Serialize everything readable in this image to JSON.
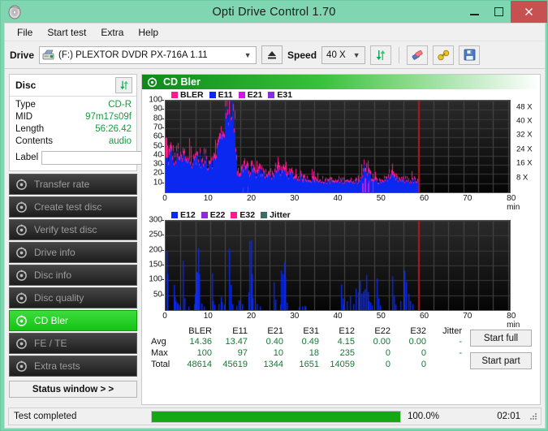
{
  "window": {
    "title": "Opti Drive Control 1.70",
    "app_icon": "disc-icon",
    "minimize": "–",
    "maximize": "□",
    "close": "✕"
  },
  "menu": [
    {
      "label": "File"
    },
    {
      "label": "Start test"
    },
    {
      "label": "Extra"
    },
    {
      "label": "Help"
    }
  ],
  "toolbar": {
    "drive_label": "Drive",
    "drive_value": "(F:)  PLEXTOR DVDR  PX-716A 1.11",
    "eject_icon": "eject-icon",
    "speed_label": "Speed",
    "speed_value": "40 X",
    "refresh_icon": "refresh-icon",
    "erase_icon": "eraser-icon",
    "tools_icon": "tools-icon",
    "save_icon": "save-icon"
  },
  "disc": {
    "header": "Disc",
    "refresh_icon": "refresh-icon",
    "rows": [
      {
        "key": "Type",
        "value": "CD-R"
      },
      {
        "key": "MID",
        "value": "97m17s09f"
      },
      {
        "key": "Length",
        "value": "56:26.42"
      },
      {
        "key": "Contents",
        "value": "audio"
      }
    ],
    "label_key": "Label",
    "label_value": "",
    "label_placeholder": "",
    "disc_icon": "cd-disc-icon"
  },
  "nav": [
    {
      "label": "Transfer rate",
      "icon": "gear-disc-icon",
      "active": false
    },
    {
      "label": "Create test disc",
      "icon": "gear-disc-icon",
      "active": false
    },
    {
      "label": "Verify test disc",
      "icon": "gear-disc-icon",
      "active": false
    },
    {
      "label": "Drive info",
      "icon": "gear-disc-icon",
      "active": false
    },
    {
      "label": "Disc info",
      "icon": "gear-disc-icon",
      "active": false
    },
    {
      "label": "Disc quality",
      "icon": "gear-disc-icon",
      "active": false
    },
    {
      "label": "CD Bler",
      "icon": "gear-disc-icon",
      "active": true
    },
    {
      "label": "FE / TE",
      "icon": "gear-disc-icon",
      "active": false
    },
    {
      "label": "Extra tests",
      "icon": "gear-disc-icon",
      "active": false
    }
  ],
  "status_window_button": "Status window > >",
  "main": {
    "header_title": "CD Bler",
    "header_icon": "gear-disc-icon"
  },
  "actions": {
    "start_full": "Start full",
    "start_part": "Start part"
  },
  "statusbar": {
    "text": "Test completed",
    "percent_label": "100.0%",
    "percent_value": 100.0,
    "elapsed": "02:01"
  },
  "stats": {
    "columns": [
      "BLER",
      "E11",
      "E21",
      "E31",
      "E12",
      "E22",
      "E32",
      "Jitter"
    ],
    "rows": [
      {
        "label": "Avg",
        "values": [
          "14.36",
          "13.47",
          "0.40",
          "0.49",
          "4.15",
          "0.00",
          "0.00",
          "-"
        ]
      },
      {
        "label": "Max",
        "values": [
          "100",
          "97",
          "10",
          "18",
          "235",
          "0",
          "0",
          "-"
        ]
      },
      {
        "label": "Total",
        "values": [
          "48614",
          "45619",
          "1344",
          "1651",
          "14059",
          "0",
          "0",
          ""
        ]
      }
    ]
  },
  "colors": {
    "bler": "#ff1a8c",
    "e11": "#0a28f0",
    "e21": "#cc1add",
    "e31": "#8d2ae0",
    "e12": "#0a28f0",
    "e22": "#8d2ae0",
    "e32": "#ff1a8c",
    "jitter": "#3c6b66",
    "marker": "#ee0000",
    "plot_bg": "#0a0a0a",
    "accent_green": "#14c414",
    "value_green": "#169b3e",
    "title_bar": "#7fd6b0"
  },
  "chart_data": [
    {
      "type": "area",
      "id": "bler-chart",
      "title": "CD Bler",
      "xlabel": "min",
      "ylabel": "",
      "xlim": [
        0,
        80
      ],
      "ylim": [
        0,
        100
      ],
      "xticks": [
        0,
        10,
        20,
        30,
        40,
        50,
        60,
        70,
        80
      ],
      "yticks": [
        10,
        20,
        30,
        40,
        50,
        60,
        70,
        80,
        90,
        100
      ],
      "right_axis_label": "X",
      "right_ticks": [
        8,
        16,
        24,
        32,
        40,
        48
      ],
      "right_ticklabels": [
        "8 X",
        "16 X",
        "24 X",
        "32 X",
        "40 X",
        "48 X"
      ],
      "right_ylim": [
        0,
        52
      ],
      "grid": true,
      "legend": [
        {
          "name": "BLER",
          "color": "#ff1a8c"
        },
        {
          "name": "E11",
          "color": "#0a28f0"
        },
        {
          "name": "E21",
          "color": "#cc1add"
        },
        {
          "name": "E31",
          "color": "#8d2ae0"
        }
      ],
      "marker_x": 56.6,
      "data_end_x": 56.5,
      "series": [
        {
          "name": "BLER",
          "color": "#ff1a8c",
          "x": [
            0.2,
            0.5,
            0.9,
            1.3,
            1.7,
            2.1,
            2.5,
            2.9,
            3.3,
            3.7,
            4.1,
            4.5,
            4.9,
            5.3,
            5.7,
            6.1,
            6.5,
            6.9,
            7.3,
            7.7,
            8.1,
            8.5,
            8.9,
            9.3,
            9.7,
            10.1,
            10.5,
            10.9,
            11.3,
            11.7,
            12.1,
            12.5,
            12.9,
            13.3,
            13.7,
            14.1,
            14.4,
            14.7,
            15.0,
            15.3,
            15.6,
            16.0,
            16.5,
            17.0,
            17.5,
            18.0,
            18.6,
            19.2,
            19.8,
            20.4,
            21.0,
            21.6,
            22.2,
            22.8,
            23.4,
            24.0,
            24.6,
            25.2,
            25.8,
            26.4,
            27.0,
            27.6,
            28.2,
            28.8,
            29.4,
            30.0,
            30.8,
            31.6,
            32.4,
            33.2,
            34.0,
            34.8,
            35.6,
            36.4,
            37.2,
            38.0,
            38.8,
            39.6,
            40.4,
            41.2,
            42.0,
            42.8,
            43.6,
            44.2,
            44.8,
            45.4,
            46.0,
            46.8,
            47.6,
            48.4,
            49.2,
            50.0,
            50.8,
            51.6,
            52.4,
            53.2,
            54.0,
            54.8,
            55.6,
            56.3
          ],
          "y": [
            53,
            38,
            44,
            47,
            40,
            36,
            42,
            46,
            33,
            38,
            44,
            31,
            35,
            41,
            30,
            33,
            38,
            44,
            34,
            39,
            30,
            36,
            42,
            31,
            35,
            40,
            33,
            38,
            45,
            52,
            58,
            66,
            72,
            80,
            86,
            92,
            97,
            100,
            86,
            78,
            62,
            26,
            22,
            25,
            34,
            28,
            24,
            27,
            23,
            21,
            25,
            22,
            20,
            24,
            21,
            19,
            30,
            26,
            22,
            27,
            24,
            20,
            22,
            18,
            17,
            19,
            15,
            17,
            14,
            16,
            13,
            15,
            12,
            14,
            13,
            12,
            14,
            13,
            15,
            12,
            14,
            13,
            16,
            28,
            26,
            22,
            18,
            14,
            12,
            13,
            15,
            20,
            18,
            16,
            14,
            13,
            15,
            13,
            14,
            12
          ]
        },
        {
          "name": "E11",
          "color": "#0a28f0",
          "x": [
            0.2,
            0.5,
            0.9,
            1.3,
            1.7,
            2.1,
            2.5,
            2.9,
            3.3,
            3.7,
            4.1,
            4.5,
            4.9,
            5.3,
            5.7,
            6.1,
            6.5,
            6.9,
            7.3,
            7.7,
            8.1,
            8.5,
            8.9,
            9.3,
            9.7,
            10.1,
            10.5,
            10.9,
            11.3,
            11.7,
            12.1,
            12.5,
            12.9,
            13.3,
            13.7,
            14.1,
            14.4,
            14.7,
            15.0,
            15.3,
            15.6,
            16.0,
            16.5,
            17.0,
            17.5,
            18.0,
            18.6,
            19.2,
            19.8,
            20.4,
            21.0,
            21.6,
            22.2,
            22.8,
            23.4,
            24.0,
            24.6,
            25.2,
            25.8,
            26.4,
            27.0,
            27.6,
            28.2,
            28.8,
            29.4,
            30.0,
            30.8,
            31.6,
            32.4,
            33.2,
            34.0,
            34.8,
            35.6,
            36.4,
            37.2,
            38.0,
            38.8,
            39.6,
            40.4,
            41.2,
            42.0,
            42.8,
            43.6,
            44.2,
            44.8,
            45.4,
            46.0,
            46.8,
            47.6,
            48.4,
            49.2,
            50.0,
            50.8,
            51.6,
            52.4,
            53.2,
            54.0,
            54.8,
            55.6,
            56.3
          ],
          "y": [
            34,
            33,
            38,
            42,
            36,
            32,
            38,
            41,
            30,
            34,
            40,
            28,
            32,
            37,
            27,
            30,
            34,
            40,
            31,
            35,
            27,
            32,
            38,
            28,
            31,
            36,
            30,
            34,
            41,
            47,
            53,
            60,
            66,
            74,
            80,
            87,
            93,
            97,
            80,
            72,
            56,
            20,
            18,
            21,
            28,
            24,
            20,
            23,
            19,
            18,
            21,
            19,
            17,
            20,
            18,
            16,
            26,
            22,
            19,
            23,
            20,
            17,
            19,
            15,
            14,
            16,
            13,
            14,
            12,
            13,
            11,
            13,
            10,
            12,
            11,
            10,
            12,
            11,
            13,
            10,
            12,
            11,
            14,
            24,
            22,
            19,
            15,
            12,
            10,
            11,
            13,
            17,
            15,
            13,
            12,
            11,
            13,
            11,
            12,
            10
          ]
        }
      ]
    },
    {
      "type": "bar",
      "id": "e12-chart",
      "title": "",
      "xlabel": "min",
      "ylabel": "",
      "xlim": [
        0,
        80
      ],
      "ylim": [
        0,
        300
      ],
      "xticks": [
        0,
        10,
        20,
        30,
        40,
        50,
        60,
        70,
        80
      ],
      "yticks": [
        50,
        100,
        150,
        200,
        250,
        300
      ],
      "grid": true,
      "legend": [
        {
          "name": "E12",
          "color": "#0a28f0"
        },
        {
          "name": "E22",
          "color": "#8d2ae0"
        },
        {
          "name": "E32",
          "color": "#ff1a8c"
        },
        {
          "name": "Jitter",
          "color": "#3c6b66"
        }
      ],
      "marker_x": 56.6,
      "series": [
        {
          "name": "E12",
          "color": "#0a28f0",
          "x": [
            0.2,
            0.4,
            1.8,
            2.0,
            2.2,
            2.5,
            2.8,
            3.1,
            3.9,
            4.2,
            5.0,
            6.3,
            6.6,
            6.9,
            7.1,
            7.3,
            7.5,
            8.0,
            8.6,
            10.3,
            10.6,
            10.9,
            11.8,
            12.3,
            12.6,
            13.0,
            14.2,
            14.5,
            14.9,
            15.8,
            16.4,
            17.1,
            18.5,
            18.8,
            19.0,
            19.2,
            19.5,
            20.4,
            21.0,
            24.2,
            24.5,
            25.6,
            25.9,
            26.2,
            26.5,
            26.8,
            27.1,
            29.8,
            30.6,
            31.0,
            31.3,
            39.3,
            39.6,
            39.9,
            40.5,
            41.3,
            42.0,
            42.6,
            43.1,
            43.5,
            43.9,
            44.2,
            44.6,
            44.9,
            45.2,
            45.5,
            45.8,
            46.2,
            47.2,
            47.6,
            48.0,
            50.7,
            51.0,
            51.4,
            52.6,
            53.4,
            53.8,
            54.3,
            54.8,
            55.3
          ],
          "y": [
            198,
            120,
            85,
            45,
            30,
            25,
            20,
            15,
            166,
            40,
            12,
            20,
            55,
            128,
            125,
            208,
            120,
            22,
            12,
            124,
            30,
            18,
            20,
            45,
            28,
            18,
            206,
            85,
            20,
            15,
            32,
            20,
            60,
            232,
            235,
            120,
            40,
            20,
            12,
            94,
            35,
            18,
            132,
            120,
            160,
            110,
            25,
            10,
            12,
            14,
            12,
            86,
            40,
            18,
            30,
            48,
            20,
            72,
            60,
            98,
            55,
            62,
            70,
            118,
            60,
            30,
            25,
            15,
            106,
            40,
            15,
            114,
            50,
            18,
            30,
            132,
            95,
            55,
            30,
            20
          ]
        }
      ]
    }
  ]
}
